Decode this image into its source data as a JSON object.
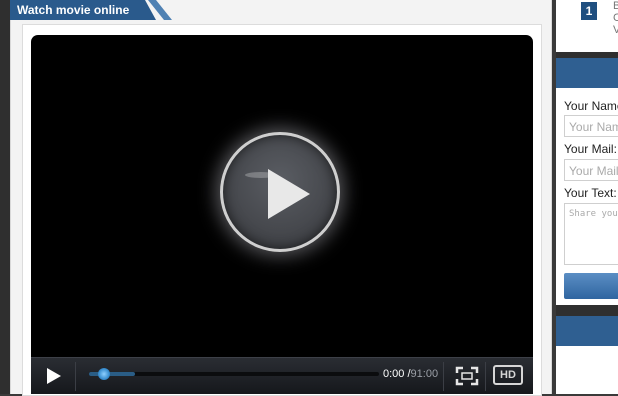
{
  "main": {
    "tab_title": "Watch movie online"
  },
  "player": {
    "current_time": "0:00",
    "separator": "/",
    "duration": "91:00",
    "hd_label": "HD",
    "buffered_fraction": 0.16,
    "played_fraction": 0.05
  },
  "sidebar": {
    "top_item": {
      "number": "1",
      "line1": "B",
      "line2": "C",
      "line3": "V"
    },
    "comment_form": {
      "name_label": "Your Name",
      "name_placeholder": "Your Nam",
      "mail_label": "Your Mail:",
      "mail_placeholder": "Your Mail",
      "text_label": "Your Text:",
      "text_placeholder": "Share your"
    }
  },
  "colors": {
    "accent": "#2a5a8c",
    "progress": "#3a8fd0"
  }
}
